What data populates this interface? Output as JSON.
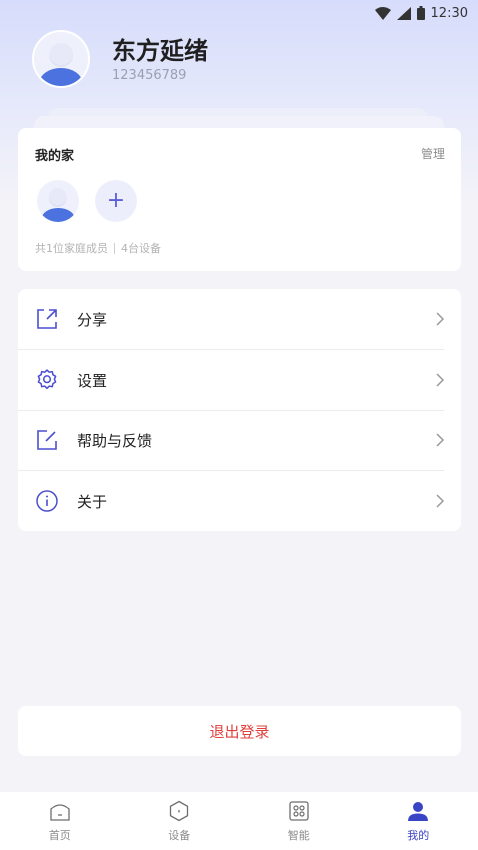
{
  "status_bar": {
    "time": "12:30"
  },
  "profile": {
    "name": "东方延绪",
    "id": "123456789"
  },
  "home": {
    "title": "我的家",
    "manage_label": "管理",
    "add_label": "+",
    "members_text": "共1位家庭成员",
    "devices_text": "4台设备"
  },
  "menu": {
    "items": [
      {
        "label": "分享",
        "icon": "share-icon"
      },
      {
        "label": "设置",
        "icon": "gear-icon"
      },
      {
        "label": "帮助与反馈",
        "icon": "feedback-icon"
      },
      {
        "label": "关于",
        "icon": "info-icon"
      }
    ]
  },
  "logout_label": "退出登录",
  "tabbar": {
    "tabs": [
      {
        "label": "首页",
        "icon": "home-icon",
        "active": false
      },
      {
        "label": "设备",
        "icon": "device-icon",
        "active": false
      },
      {
        "label": "智能",
        "icon": "smart-icon",
        "active": false
      },
      {
        "label": "我的",
        "icon": "user-icon",
        "active": true
      }
    ]
  },
  "colors": {
    "accent": "#5b5fd8",
    "active_tab": "#3a45c6",
    "logout": "#e0403c",
    "avatar_body": "#4c72e0"
  }
}
